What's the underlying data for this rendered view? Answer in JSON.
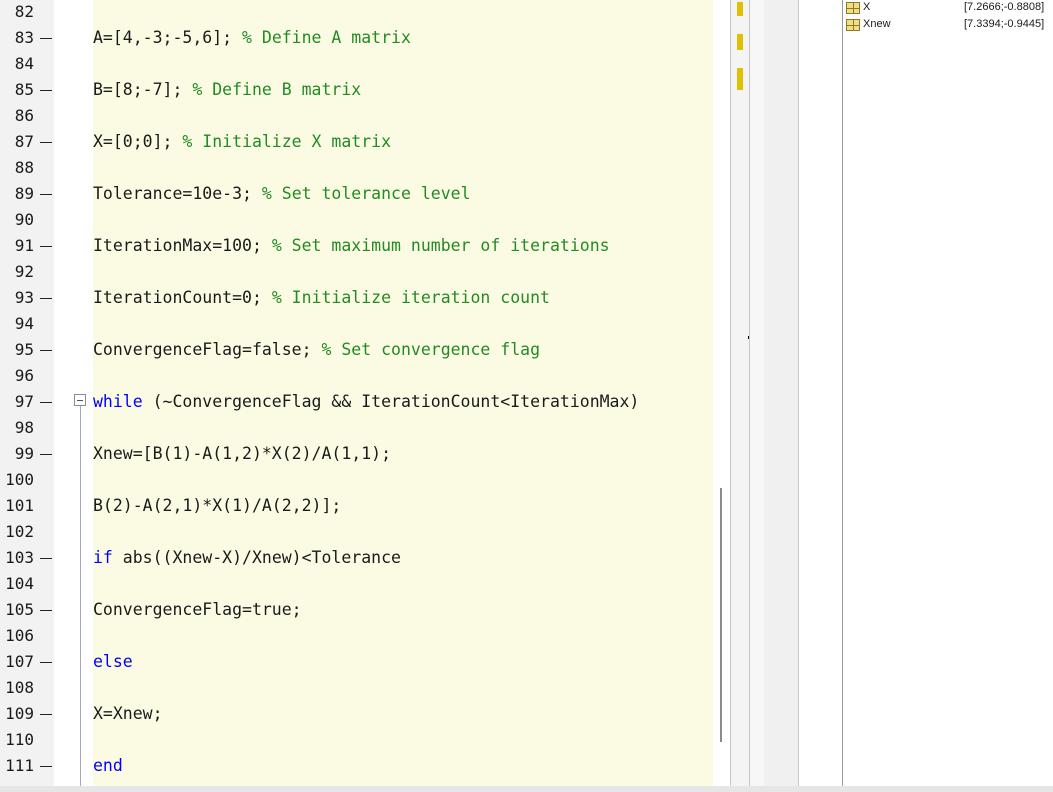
{
  "editor": {
    "lines": [
      {
        "num": "82",
        "dash": false,
        "segments": []
      },
      {
        "num": "83",
        "dash": true,
        "segments": [
          {
            "t": "A=[4,-3;-5,6]; ",
            "c": ""
          },
          {
            "t": "% Define A matrix",
            "c": "cm"
          }
        ]
      },
      {
        "num": "84",
        "dash": false,
        "segments": []
      },
      {
        "num": "85",
        "dash": true,
        "segments": [
          {
            "t": "B=[8;-7]; ",
            "c": ""
          },
          {
            "t": "% Define B matrix",
            "c": "cm"
          }
        ]
      },
      {
        "num": "86",
        "dash": false,
        "segments": []
      },
      {
        "num": "87",
        "dash": true,
        "segments": [
          {
            "t": "X=[0;0]; ",
            "c": ""
          },
          {
            "t": "% Initialize X matrix",
            "c": "cm"
          }
        ]
      },
      {
        "num": "88",
        "dash": false,
        "segments": []
      },
      {
        "num": "89",
        "dash": true,
        "segments": [
          {
            "t": "Tolerance=10e-3; ",
            "c": ""
          },
          {
            "t": "% Set tolerance level",
            "c": "cm"
          }
        ]
      },
      {
        "num": "90",
        "dash": false,
        "segments": []
      },
      {
        "num": "91",
        "dash": true,
        "segments": [
          {
            "t": "IterationMax=100; ",
            "c": ""
          },
          {
            "t": "% Set maximum number of iterations",
            "c": "cm"
          }
        ]
      },
      {
        "num": "92",
        "dash": false,
        "segments": []
      },
      {
        "num": "93",
        "dash": true,
        "segments": [
          {
            "t": "IterationCount=0; ",
            "c": ""
          },
          {
            "t": "% Initialize iteration count",
            "c": "cm"
          }
        ]
      },
      {
        "num": "94",
        "dash": false,
        "segments": []
      },
      {
        "num": "95",
        "dash": true,
        "segments": [
          {
            "t": "ConvergenceFlag=false; ",
            "c": ""
          },
          {
            "t": "% Set convergence flag",
            "c": "cm"
          }
        ]
      },
      {
        "num": "96",
        "dash": false,
        "segments": []
      },
      {
        "num": "97",
        "dash": true,
        "segments": [
          {
            "t": "while",
            "c": "kw"
          },
          {
            "t": " (~ConvergenceFlag && IterationCount<IterationMax)",
            "c": ""
          }
        ]
      },
      {
        "num": "98",
        "dash": false,
        "segments": []
      },
      {
        "num": "99",
        "dash": true,
        "segments": [
          {
            "t": "Xnew=[B(1)-A(1,2)*X(2)/A(1,1);",
            "c": ""
          }
        ]
      },
      {
        "num": "100",
        "dash": false,
        "segments": []
      },
      {
        "num": "101",
        "dash": false,
        "segments": [
          {
            "t": "B(2)-A(2,1)*X(1)/A(2,2)];",
            "c": ""
          }
        ]
      },
      {
        "num": "102",
        "dash": false,
        "segments": []
      },
      {
        "num": "103",
        "dash": true,
        "segments": [
          {
            "t": "if",
            "c": "kw"
          },
          {
            "t": " abs((Xnew-X)/Xnew)<Tolerance",
            "c": ""
          }
        ]
      },
      {
        "num": "104",
        "dash": false,
        "segments": []
      },
      {
        "num": "105",
        "dash": true,
        "segments": [
          {
            "t": "ConvergenceFlag=true;",
            "c": ""
          }
        ]
      },
      {
        "num": "106",
        "dash": false,
        "segments": []
      },
      {
        "num": "107",
        "dash": true,
        "segments": [
          {
            "t": "else",
            "c": "kw"
          }
        ]
      },
      {
        "num": "108",
        "dash": false,
        "segments": []
      },
      {
        "num": "109",
        "dash": true,
        "segments": [
          {
            "t": "X=Xnew;",
            "c": ""
          }
        ]
      },
      {
        "num": "110",
        "dash": false,
        "segments": []
      },
      {
        "num": "111",
        "dash": true,
        "segments": [
          {
            "t": "end",
            "c": "kw"
          }
        ]
      }
    ]
  },
  "workspace": {
    "variables": [
      {
        "name": "X",
        "value": "[7.2666;-0.8808]",
        "icon": "matrix-icon"
      },
      {
        "name": "Xnew",
        "value": "[7.3394;-0.9445]",
        "icon": "matrix-icon"
      }
    ]
  },
  "colors": {
    "code_background": "#fbfbe4",
    "keyword": "#0000ff",
    "comment": "#228b22",
    "analyzer_marker": "#e0c000"
  }
}
